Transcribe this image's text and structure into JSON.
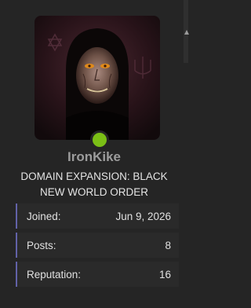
{
  "user": {
    "name": "IronKike",
    "title_lines": [
      "DOMAIN EXPANSION: BLACK",
      "NEW WORLD ORDER"
    ],
    "online": true
  },
  "stats": [
    {
      "label": "Joined:",
      "value": "Jun 9, 2026"
    },
    {
      "label": "Posts:",
      "value": "8"
    },
    {
      "label": "Reputation:",
      "value": "16"
    }
  ],
  "colors": {
    "background": "#252525",
    "online_status": "#7bbf16",
    "stat_accent": "#6262a8",
    "username": "#9c9c9c"
  }
}
